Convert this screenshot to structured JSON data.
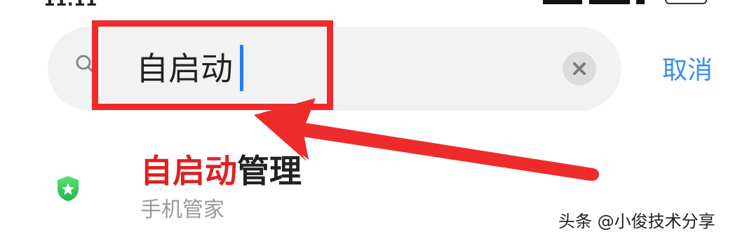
{
  "status_bar": {
    "time": "11:11"
  },
  "search": {
    "query": "自启动",
    "clear_icon": "close-icon",
    "search_icon": "search-icon"
  },
  "cancel_label": "取消",
  "result": {
    "title_match": "自启动",
    "title_rest": "管理",
    "subtitle": "手机管家",
    "icon": "shield-star-icon",
    "match_color": "#e02020"
  },
  "annotation": {
    "color": "#ee2b2b"
  },
  "watermark": "头条 @小俊技术分享"
}
